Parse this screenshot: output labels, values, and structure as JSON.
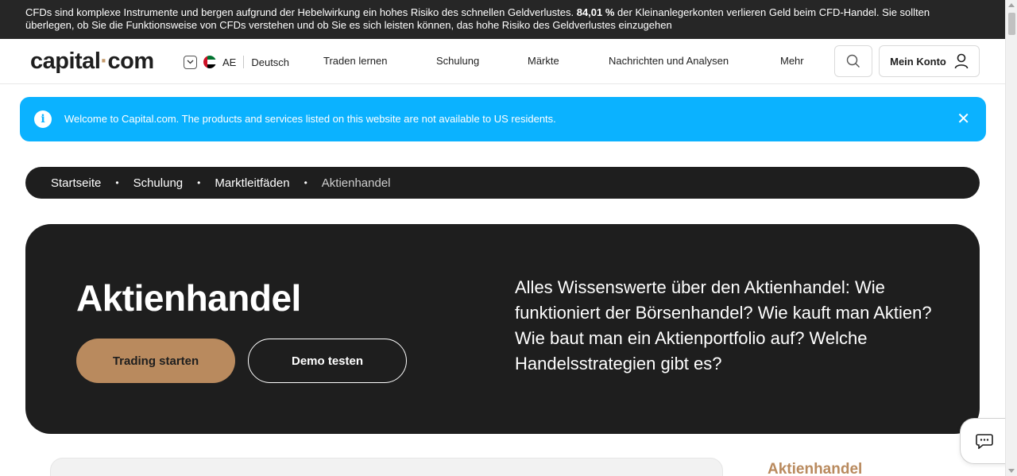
{
  "risk_warning": {
    "before": "CFDs sind komplexe Instrumente und bergen aufgrund der Hebelwirkung ein hohes Risiko des schnellen Geldverlustes.",
    "percent": "84,01 %",
    "after": "der Kleinanlegerkonten verlieren Geld beim CFD-Handel. Sie sollten überlegen, ob Sie die Funktionsweise von CFDs verstehen und ob Sie es sich leisten können, das hohe Risiko des Geldverlustes einzugehen"
  },
  "header": {
    "logo_main": "capital",
    "logo_dot": "·",
    "logo_tld": "com",
    "region_code": "AE",
    "language": "Deutsch",
    "nav": [
      "Traden lernen",
      "Schulung",
      "Märkte",
      "Nachrichten und Analysen",
      "Mehr"
    ],
    "account_label": "Mein Konto"
  },
  "notice": {
    "text": "Welcome to Capital.com. The products and services listed on this website are not available to US residents.",
    "close": "✕",
    "info": "i"
  },
  "breadcrumb": {
    "items": [
      "Startseite",
      "Schulung",
      "Marktleitfäden"
    ],
    "current": "Aktienhandel",
    "separator": "•"
  },
  "hero": {
    "title": "Aktienhandel",
    "primary_button": "Trading starten",
    "secondary_button": "Demo testen",
    "description": "Alles Wissenswerte über den Aktienhandel: Wie funktioniert der Börsenhandel? Wie kauft man Aktien? Wie baut man ein Aktienportfolio auf? Welche Handelsstrategien gibt es?"
  },
  "sidebar": {
    "toc_title": "Aktienhandel"
  },
  "colors": {
    "accent_brown": "#b98a5e",
    "notice_blue": "#0bb2ff",
    "dark": "#1e1e1e"
  }
}
